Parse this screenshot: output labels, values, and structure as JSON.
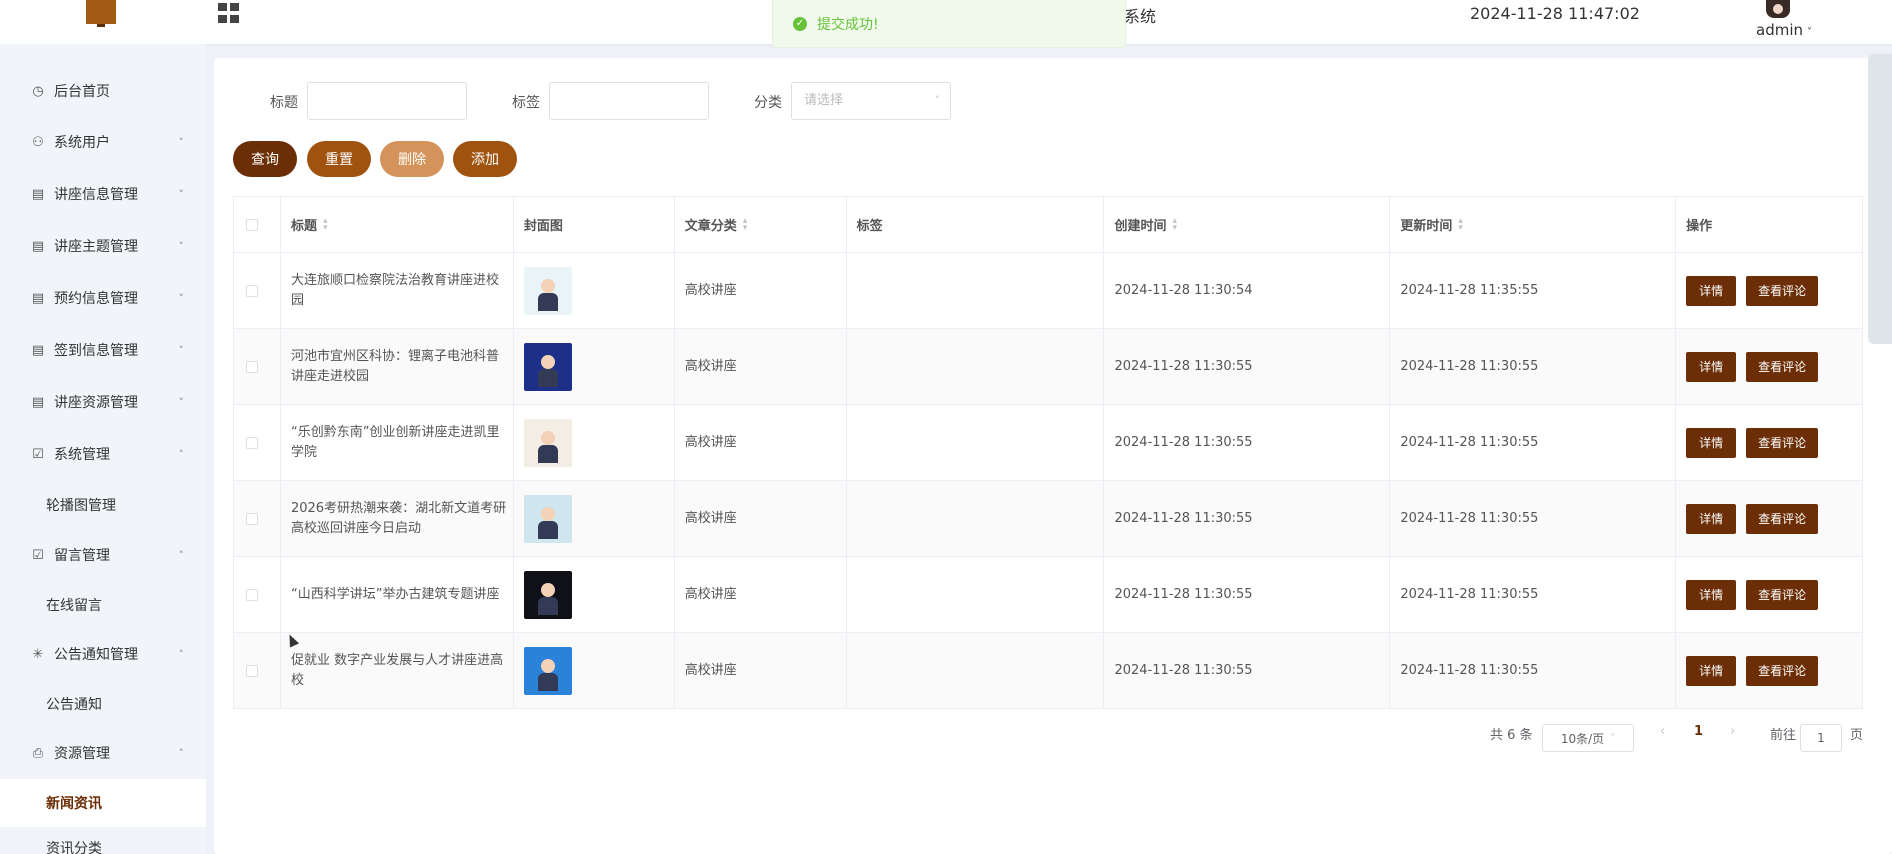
{
  "header": {
    "sys_title_fragment": "系统",
    "datetime": "2024-11-28 11:47:02",
    "user": "admin"
  },
  "toast": {
    "message": "提交成功!",
    "icon": "success-check-icon"
  },
  "sidebar": {
    "items": [
      {
        "label": "后台首页",
        "icon": "clock-icon"
      },
      {
        "label": "系统用户",
        "icon": "user-icon",
        "arrow": "˅"
      },
      {
        "label": "讲座信息管理",
        "icon": "card-icon",
        "arrow": "˅"
      },
      {
        "label": "讲座主题管理",
        "icon": "card-icon",
        "arrow": "˅"
      },
      {
        "label": "预约信息管理",
        "icon": "card-icon",
        "arrow": "˅"
      },
      {
        "label": "签到信息管理",
        "icon": "card-icon",
        "arrow": "˅"
      },
      {
        "label": "讲座资源管理",
        "icon": "card-icon",
        "arrow": "˅"
      },
      {
        "label": "系统管理",
        "icon": "inbox-icon",
        "arrow": "˄"
      },
      {
        "label": "留言管理",
        "icon": "inbox-icon",
        "arrow": "˄"
      },
      {
        "label": "公告通知管理",
        "icon": "loading-icon",
        "arrow": "˄"
      },
      {
        "label": "资源管理",
        "icon": "printer-icon",
        "arrow": "˄"
      }
    ],
    "subs": {
      "carousel": "轮播图管理",
      "message": "在线留言",
      "notice": "公告通知",
      "news": "新闻资讯",
      "news_cat": "资讯分类"
    }
  },
  "filters": {
    "title_label": "标题",
    "tag_label": "标签",
    "category_label": "分类",
    "category_placeholder": "请选择"
  },
  "buttons": {
    "query": "查询",
    "reset": "重置",
    "delete": "删除",
    "add": "添加"
  },
  "table": {
    "headers": [
      "标题",
      "封面图",
      "文章分类",
      "标签",
      "创建时间",
      "更新时间",
      "操作"
    ],
    "detail_label": "详情",
    "comments_label": "查看评论",
    "rows": [
      {
        "title": "大连旅顺口检察院法治教育讲座进校园",
        "category": "高校讲座",
        "tag": "",
        "created": "2024-11-28 11:30:54",
        "updated": "2024-11-28 11:35:55",
        "thumb_bg": "#e8f4f8"
      },
      {
        "title": "河池市宜州区科协：锂离子电池科普讲座走进校园",
        "category": "高校讲座",
        "tag": "",
        "created": "2024-11-28 11:30:55",
        "updated": "2024-11-28 11:30:55",
        "thumb_bg": "#1e2f8a"
      },
      {
        "title": "“乐创黔东南”创业创新讲座走进凯里学院",
        "category": "高校讲座",
        "tag": "",
        "created": "2024-11-28 11:30:55",
        "updated": "2024-11-28 11:30:55",
        "thumb_bg": "#f3ede4"
      },
      {
        "title": "2026考研热潮来袭：湖北新文道考研高校巡回讲座今日启动",
        "category": "高校讲座",
        "tag": "",
        "created": "2024-11-28 11:30:55",
        "updated": "2024-11-28 11:30:55",
        "thumb_bg": "#cfe6ee"
      },
      {
        "title": "“山西科学讲坛”举办古建筑专题讲座",
        "category": "高校讲座",
        "tag": "",
        "created": "2024-11-28 11:30:55",
        "updated": "2024-11-28 11:30:55",
        "thumb_bg": "#101018"
      },
      {
        "title": "促就业 数字产业发展与人才讲座进高校",
        "category": "高校讲座",
        "tag": "",
        "created": "2024-11-28 11:30:55",
        "updated": "2024-11-28 11:30:55",
        "thumb_bg": "#2b82d9"
      }
    ]
  },
  "pagination": {
    "total": "共 6 条",
    "page_size": "10条/页",
    "current": "1",
    "goto_prefix": "前往",
    "goto_value": "1",
    "goto_suffix": "页"
  },
  "colors": {
    "brand_dark": "#6b2e06",
    "btn_query": "#6b2e06",
    "btn_reset": "#a0520f",
    "btn_delete": "#d4935a",
    "btn_add": "#a0520f",
    "success": "#67c23a"
  }
}
